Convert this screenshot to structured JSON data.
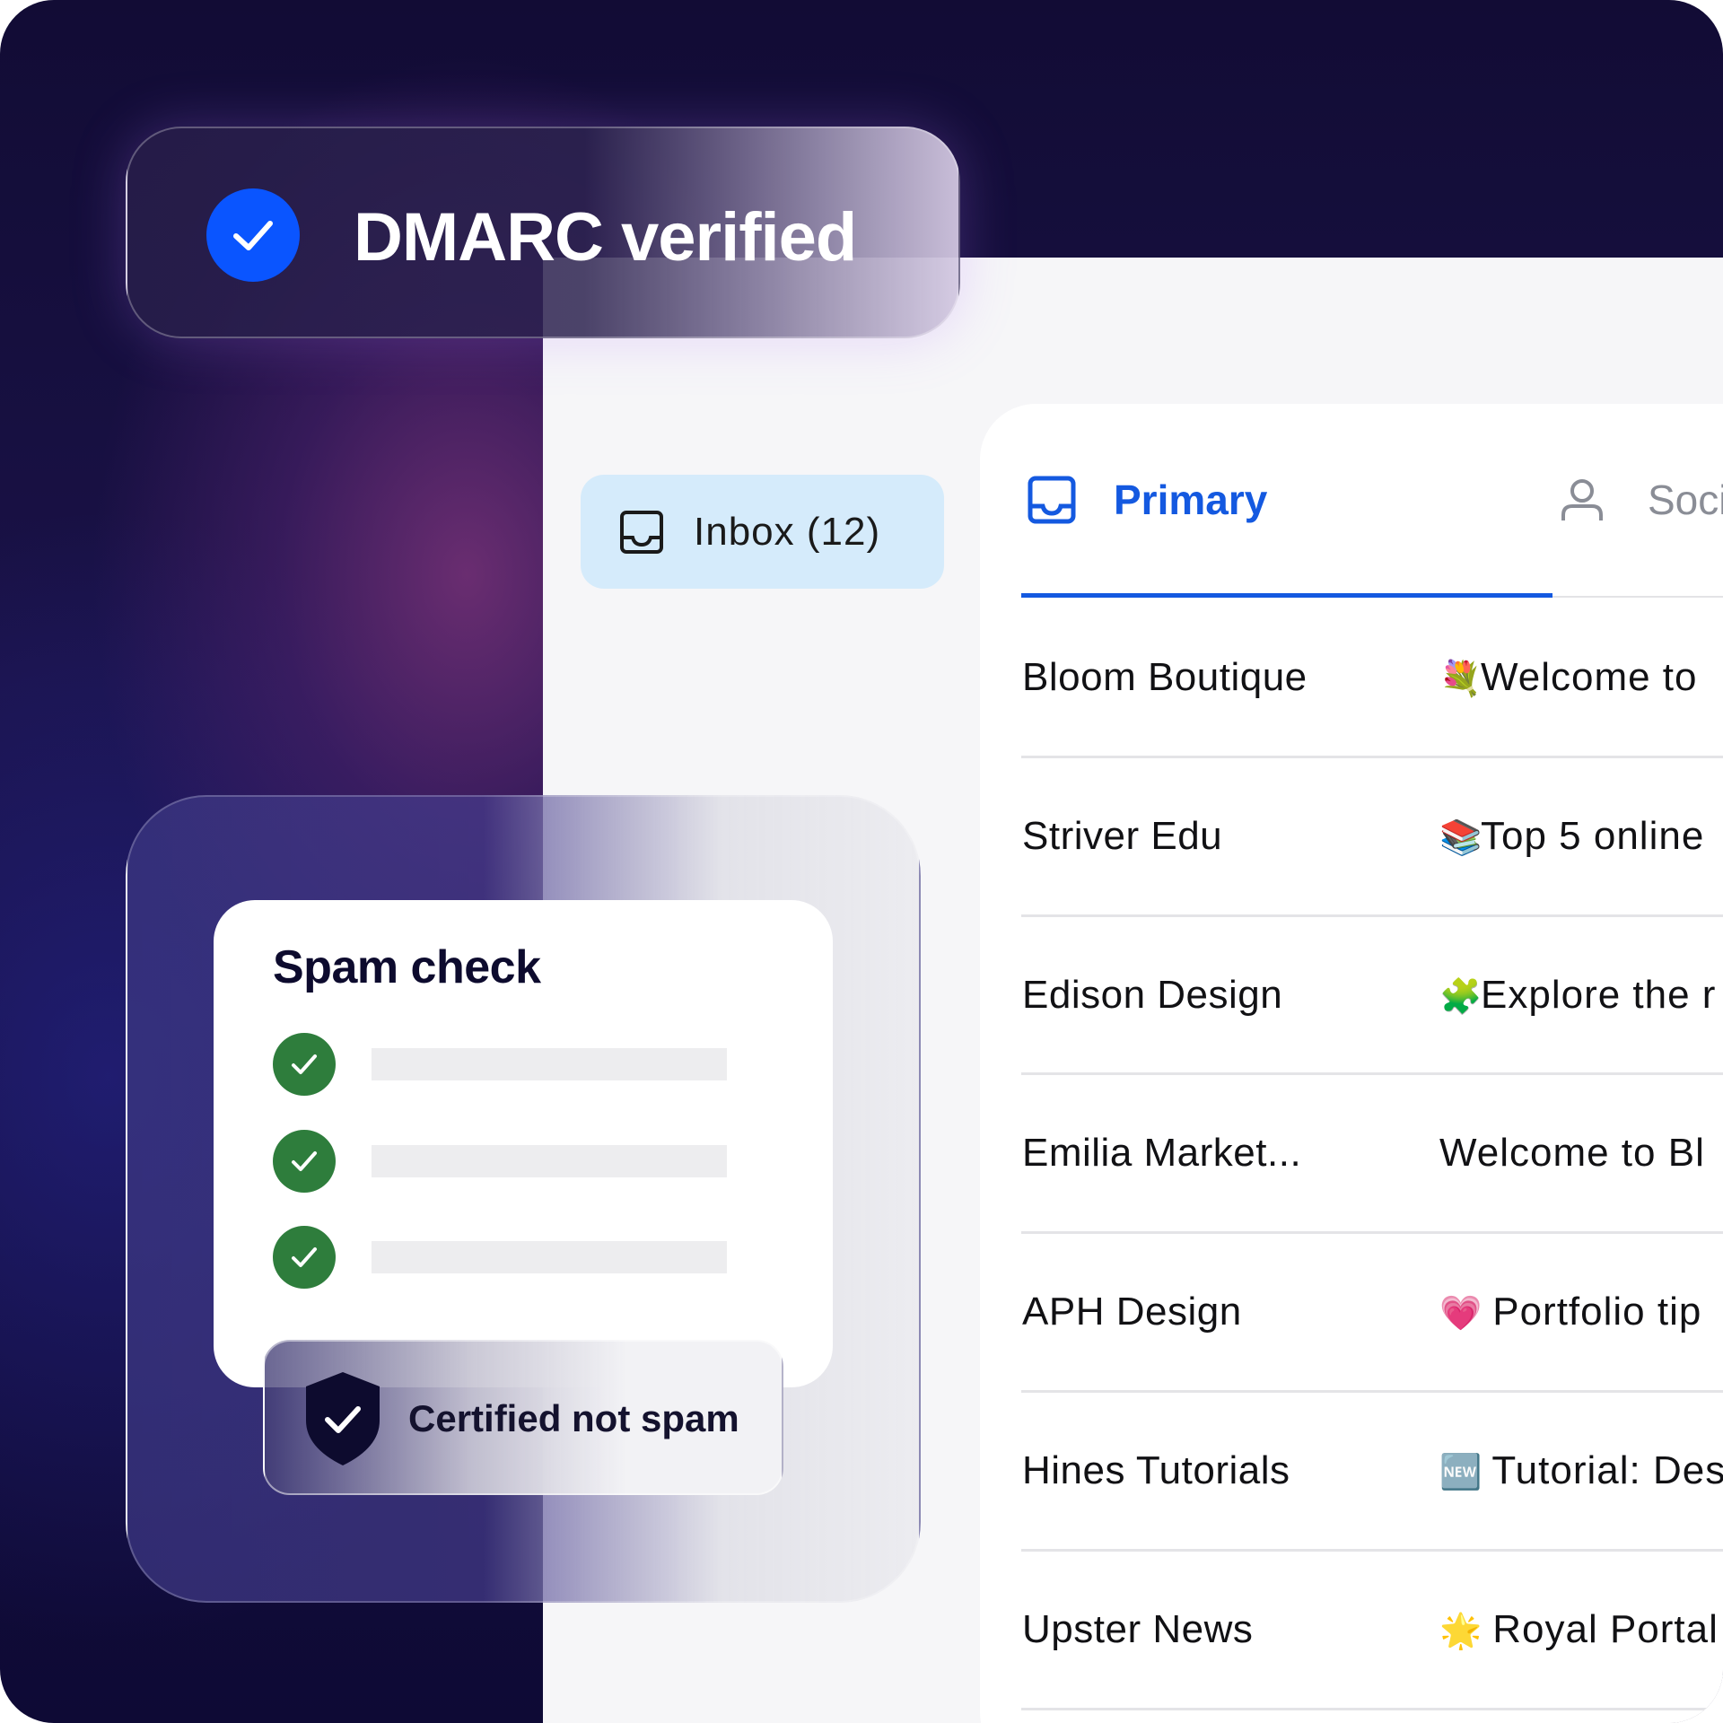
{
  "dmarc": {
    "title": "DMARC verified"
  },
  "sidebar": {
    "inbox_label": "Inbox (12)"
  },
  "tabs": [
    {
      "label": "Primary",
      "active": true,
      "icon": "inbox-icon"
    },
    {
      "label": "Soci",
      "active": false,
      "icon": "person-icon"
    }
  ],
  "emails": [
    {
      "sender": "Bloom Boutique",
      "emoji": "💐",
      "subject": "Welcome to"
    },
    {
      "sender": "Striver Edu",
      "emoji": "📚",
      "subject": "Top 5 online"
    },
    {
      "sender": "Edison Design",
      "emoji": "🧩",
      "subject": "Explore the r"
    },
    {
      "sender": "Emilia Market...",
      "emoji": "",
      "subject": "Welcome to Bl"
    },
    {
      "sender": "APH Design",
      "emoji": "💗",
      "subject": " Portfolio tip"
    },
    {
      "sender": "Hines Tutorials",
      "emoji": "🆕",
      "subject": " Tutorial: Des"
    },
    {
      "sender": "Upster News",
      "emoji": "🌟",
      "subject": " Royal Portal"
    }
  ],
  "spam_check": {
    "title": "Spam check",
    "items_passed": 3,
    "certified_label": "Certified not spam"
  },
  "colors": {
    "accent_blue": "#1459e0",
    "check_blue": "#0a55ff",
    "check_green": "#2e7d3c",
    "inbox_pill": "#d5ebfb"
  }
}
